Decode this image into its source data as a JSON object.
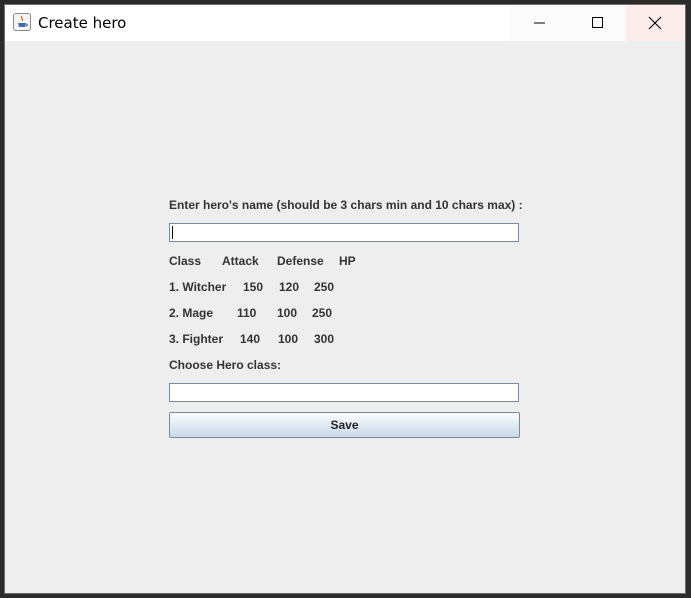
{
  "window": {
    "title": "Create hero"
  },
  "form": {
    "name_prompt": "Enter hero's name (should be 3 chars min and 10 chars max) :",
    "name_value": "",
    "table": {
      "headers": [
        "Class",
        "Attack",
        "Defense",
        "HP"
      ],
      "rows": [
        [
          "1. Witcher",
          "150",
          "120",
          "250"
        ],
        [
          "2. Mage",
          "110",
          "100",
          "250"
        ],
        [
          "3. Fighter",
          "140",
          "100",
          "300"
        ]
      ]
    },
    "class_prompt": "Choose Hero class:",
    "class_value": "",
    "save_label": "Save"
  },
  "icons": {
    "app": "java-cup-icon",
    "minimize": "minimize-icon",
    "maximize": "maximize-icon",
    "close": "close-icon"
  }
}
